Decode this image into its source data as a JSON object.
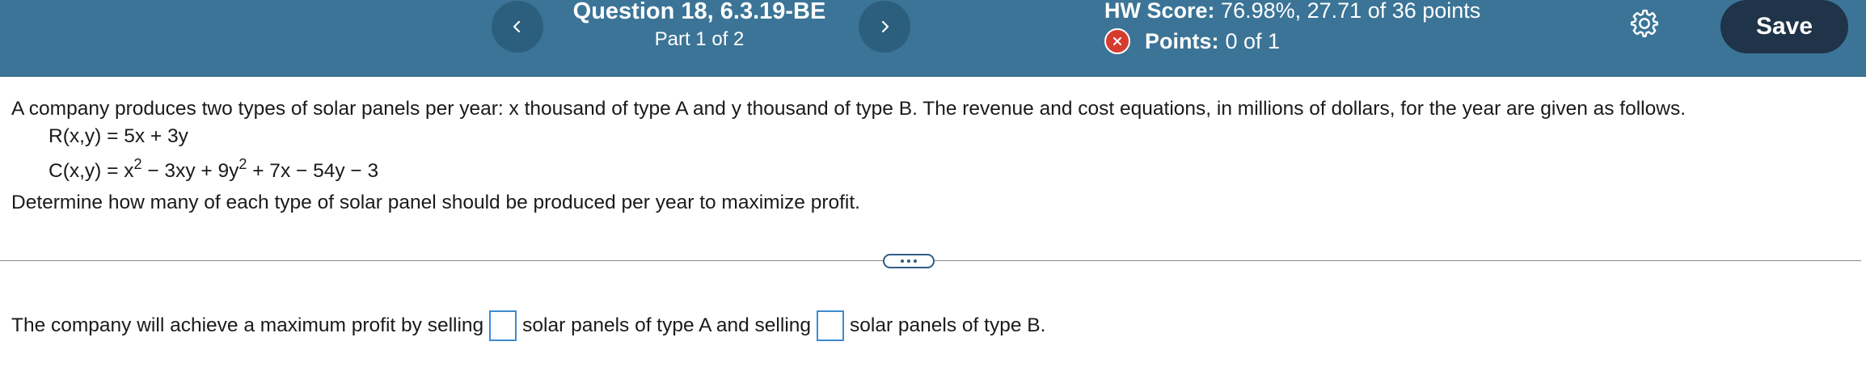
{
  "header": {
    "question_title": "Question 18, 6.3.19-BE",
    "part": "Part 1 of 2",
    "prev_icon": "chevron-left-icon",
    "next_icon": "chevron-right-icon",
    "hw_score_label": "HW Score:",
    "hw_score_value": "76.98%, 27.71 of 36 points",
    "points_label": "Points:",
    "points_value": "0 of 1",
    "points_status_icon": "x-circle-icon",
    "settings_icon": "gear-icon",
    "save_label": "Save",
    "colors": {
      "bar": "#3b7496",
      "nav_button": "#2c5f7d",
      "save_button": "#1f3349",
      "incorrect": "#d63c2e",
      "input_border": "#3d8bd0"
    }
  },
  "question": {
    "intro": "A company produces two types of solar panels per year: x thousand of type A and y thousand of type B. The revenue and cost equations, in millions of dollars, for the year are given as follows.",
    "revenue_eq": "R(x,y) = 5x + 3y",
    "cost_eq_part1": "C(x,y) = x",
    "cost_eq_exp1": "2",
    "cost_eq_part2": " − 3xy + 9y",
    "cost_eq_exp2": "2",
    "cost_eq_part3": " + 7x − 54y − 3",
    "instruction": "Determine how many of each type of solar panel should be produced per year to maximize profit."
  },
  "divider": {
    "more_icon": "ellipsis-icon"
  },
  "answer": {
    "text_before": "The company will achieve a maximum profit by selling",
    "input_a_value": "",
    "text_middle": "solar panels of type A and selling",
    "input_b_value": "",
    "text_after": "solar panels of type B."
  }
}
